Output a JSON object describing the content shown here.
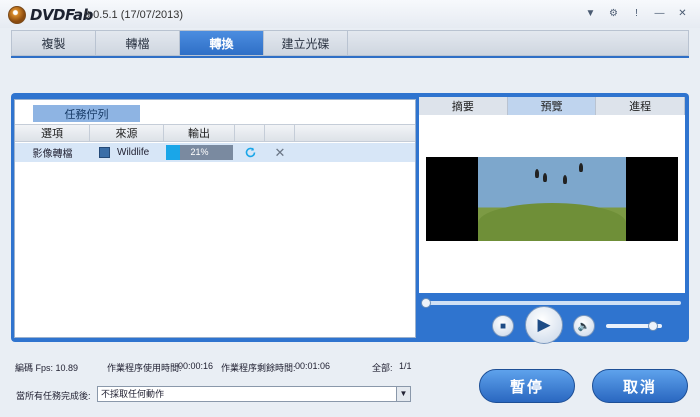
{
  "app": {
    "brand": "DVDFab",
    "version": "9.0.5.1 (17/07/2013)"
  },
  "window_controls": [
    {
      "name": "menu-icon",
      "glyph": "▼"
    },
    {
      "name": "settings-icon",
      "glyph": "⚙"
    },
    {
      "name": "help-icon",
      "glyph": "!"
    },
    {
      "name": "minimize-icon",
      "glyph": "—"
    },
    {
      "name": "close-icon",
      "glyph": "✕"
    }
  ],
  "tabs": [
    {
      "label": "複製",
      "active": false
    },
    {
      "label": "轉檔",
      "active": false
    },
    {
      "label": "轉換",
      "active": true
    },
    {
      "label": "建立光碟",
      "active": false
    }
  ],
  "queue": {
    "tab_label": "任務佇列",
    "columns": [
      "選項",
      "來源",
      "輸出"
    ],
    "row": {
      "type": "影像轉檔",
      "source": "Wildlife",
      "progress": 21,
      "progress_label": "21%"
    }
  },
  "right_tabs": [
    {
      "label": "摘要",
      "active": false
    },
    {
      "label": "預覽",
      "active": true
    },
    {
      "label": "進程",
      "active": false
    }
  ],
  "player": {
    "seek_position": 0,
    "volume": 0.8
  },
  "stats": {
    "encode_fps": "編碼 Fps: 10.89",
    "elapsed_label": "作業程序使用時間:",
    "elapsed": "00:00:16",
    "remaining_label": "作業程序剩餘時間:",
    "remaining": "00:01:06",
    "total_label": "全部:",
    "total": "1/1"
  },
  "after_done": {
    "label": "當所有任務完成後:",
    "value": "不採取任何動作"
  },
  "buttons": {
    "pause": "暫停",
    "cancel": "取消"
  },
  "colors": {
    "accent": "#2f74cf",
    "progress": "#1aa6e8"
  }
}
